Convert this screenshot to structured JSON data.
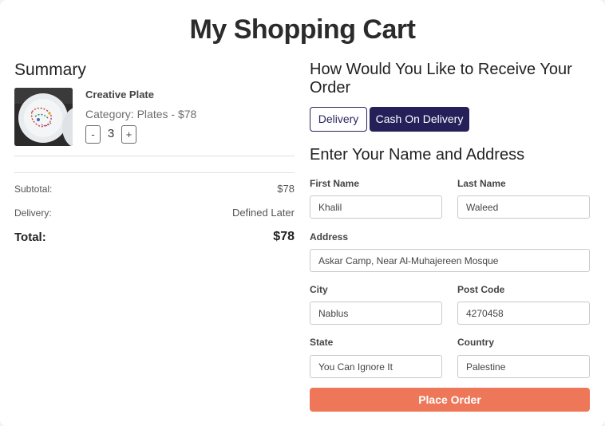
{
  "page": {
    "title": "My Shopping Cart"
  },
  "summary": {
    "title": "Summary",
    "item": {
      "name": "Creative Plate",
      "category": "Category: Plates - $78",
      "quantity": "3",
      "minus_label": "-",
      "plus_label": "+"
    },
    "subtotal_label": "Subtotal:",
    "subtotal_value": "$78",
    "delivery_label": "Delivery:",
    "delivery_value": "Defined Later",
    "total_label": "Total:",
    "total_value": "$78"
  },
  "receive": {
    "title": "How Would You Like to Receive Your Order",
    "options": [
      "Delivery",
      "Cash On Delivery"
    ],
    "selected": "Cash On Delivery"
  },
  "address": {
    "title": "Enter Your Name and Address",
    "first_name": {
      "label": "First Name",
      "value": "Khalil"
    },
    "last_name": {
      "label": "Last Name",
      "value": "Waleed"
    },
    "address": {
      "label": "Address",
      "value": "Askar Camp, Near Al-Muhajereen Mosque"
    },
    "city": {
      "label": "City",
      "value": "Nablus"
    },
    "post_code": {
      "label": "Post Code",
      "value": "4270458"
    },
    "state": {
      "label": "State",
      "value": "You Can Ignore It"
    },
    "country": {
      "label": "Country",
      "value": "Palestine"
    }
  },
  "actions": {
    "place_order": "Place Order"
  },
  "colors": {
    "accent": "#26205a",
    "order_button": "#ee7759"
  }
}
